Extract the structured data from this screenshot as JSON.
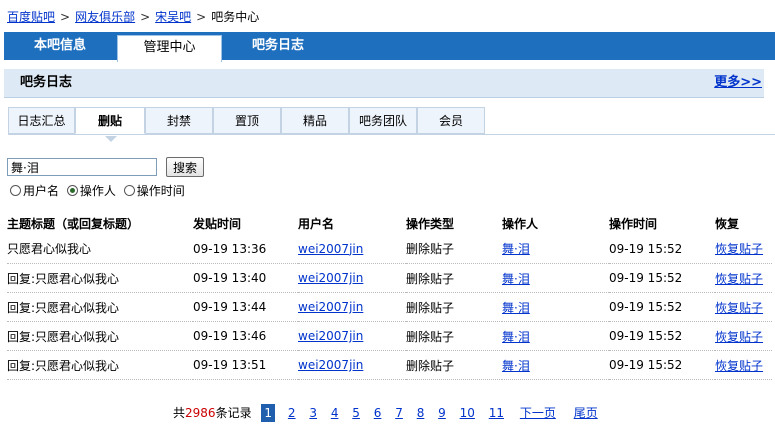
{
  "breadcrumb": {
    "items": [
      "百度贴吧",
      "网友俱乐部",
      "宋吴吧"
    ],
    "current": "吧务中心",
    "separator": ">"
  },
  "main_nav": {
    "tabs": [
      "本吧信息",
      "管理中心",
      "吧务日志"
    ],
    "active": "管理中心"
  },
  "panel": {
    "title": "吧务日志",
    "more_link": "更多>>"
  },
  "sub_tabs": {
    "items": [
      "日志汇总",
      "删贴",
      "封禁",
      "置顶",
      "精品",
      "吧务团队",
      "会员"
    ],
    "active": "删贴"
  },
  "search": {
    "value": "舞·泪",
    "button_label": "搜索",
    "options": [
      "用户名",
      "操作人",
      "操作时间"
    ],
    "selected": "操作人"
  },
  "table": {
    "headers": [
      "主题标题（或回复标题）",
      "发贴时间",
      "用户名",
      "操作类型",
      "操作人",
      "操作时间",
      "恢复"
    ],
    "rows": [
      [
        "只愿君心似我心",
        "09-19 13:36",
        "wei2007jin",
        "删除贴子",
        "舞·泪",
        "09-19 15:52",
        "恢复贴子"
      ],
      [
        "回复:只愿君心似我心",
        "09-19 13:40",
        "wei2007jin",
        "删除贴子",
        "舞·泪",
        "09-19 15:52",
        "恢复贴子"
      ],
      [
        "回复:只愿君心似我心",
        "09-19 13:44",
        "wei2007jin",
        "删除贴子",
        "舞·泪",
        "09-19 15:52",
        "恢复贴子"
      ],
      [
        "回复:只愿君心似我心",
        "09-19 13:46",
        "wei2007jin",
        "删除贴子",
        "舞·泪",
        "09-19 15:52",
        "恢复贴子"
      ],
      [
        "回复:只愿君心似我心",
        "09-19 13:51",
        "wei2007jin",
        "删除贴子",
        "舞·泪",
        "09-19 15:52",
        "恢复贴子"
      ]
    ]
  },
  "pager": {
    "total_prefix": "共",
    "total_count": "2986",
    "total_suffix": "条记录",
    "pages": [
      "1",
      "2",
      "3",
      "4",
      "5",
      "6",
      "7",
      "8",
      "9",
      "10",
      "11"
    ],
    "current": "1",
    "next_label": "下一页",
    "last_label": "尾页"
  },
  "colors": {
    "nav_bg": "#1f6fbf",
    "panel_header_bg": "#dde9f5",
    "link": "#0033cc",
    "count_red": "#cc0000"
  }
}
